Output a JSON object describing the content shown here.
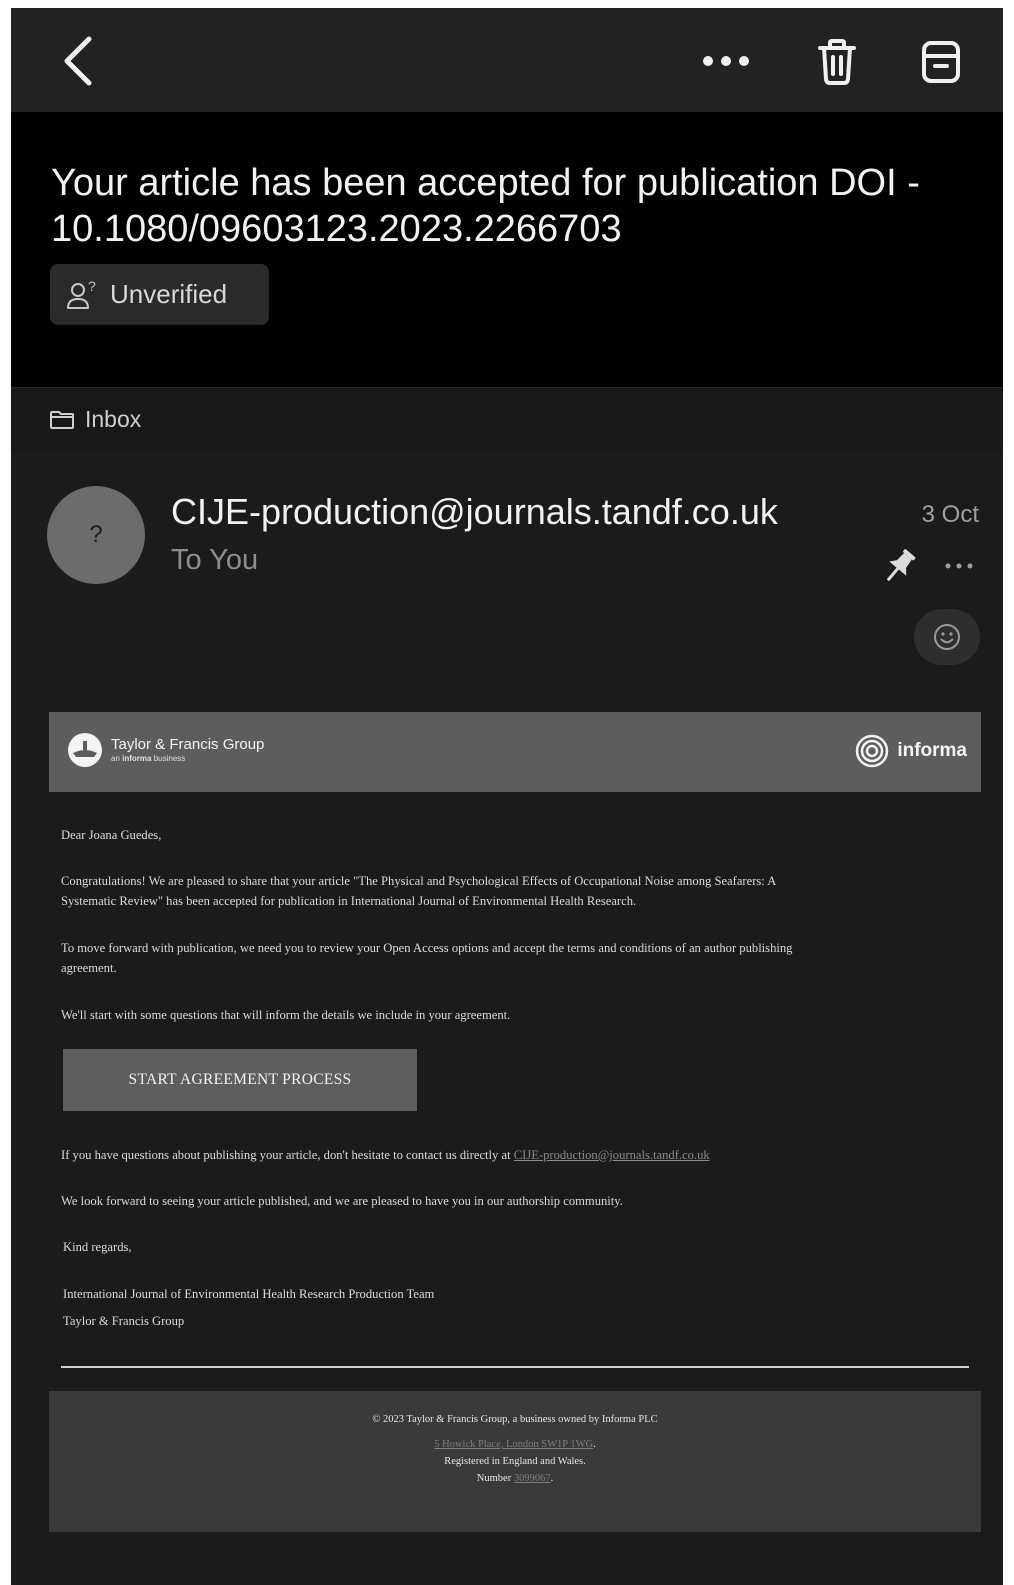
{
  "toolbar": {
    "back_icon": "chevron-left-icon",
    "more_icon": "more-horizontal-icon",
    "delete_icon": "trash-icon",
    "archive_icon": "archive-icon"
  },
  "subject": {
    "line1": "Your article has been accepted for publication DOI -",
    "line2": "10.1080/09603123.2023.2266703",
    "badge": "Unverified"
  },
  "folder": {
    "label": "Inbox"
  },
  "message": {
    "avatar_initial": "?",
    "sender": "CIJE-production@journals.tandf.co.uk",
    "recipient": "To You",
    "date": "3 Oct"
  },
  "email": {
    "banner": {
      "brand_name": "Taylor & Francis Group",
      "brand_sub_prefix": "an ",
      "brand_sub_bold": "informa",
      "brand_sub_suffix": " business",
      "partner": "informa"
    },
    "greeting": "Dear Joana Guedes,",
    "para1_line1": "Congratulations! We are pleased to share that your article \"The Physical and Psychological Effects of Occupational Noise among Seafarers: A",
    "para1_line2": "Systematic Review\" has been accepted for publication in International Journal of Environmental Health Research.",
    "para2_line1": "To move forward with publication, we need you to review your Open Access options and accept the terms and conditions of an author publishing",
    "para2_line2": "agreement.",
    "para3": "We'll start with some questions that will inform the details we include in your agreement.",
    "cta": "START AGREEMENT PROCESS",
    "contact_text": "If you have questions about publishing your article, don't hesitate to contact us directly at ",
    "contact_link": "CIJE-production@journals.tandf.co.uk",
    "closing_para": "We look forward to seeing your article published, and we are pleased to have you in our authorship community.",
    "regards": "Kind regards,",
    "sig1": "International Journal of Environmental Health Research Production Team",
    "sig2": "Taylor & Francis Group",
    "footer": {
      "copyright": "© 2023 Taylor & Francis Group, a business owned by Informa PLC",
      "address": "5 Howick Place, London SW1P 1WG",
      "address_suffix": ".",
      "registered": "Registered in England and Wales.",
      "number_label": "Number ",
      "number": "3099067",
      "number_suffix": "."
    }
  }
}
